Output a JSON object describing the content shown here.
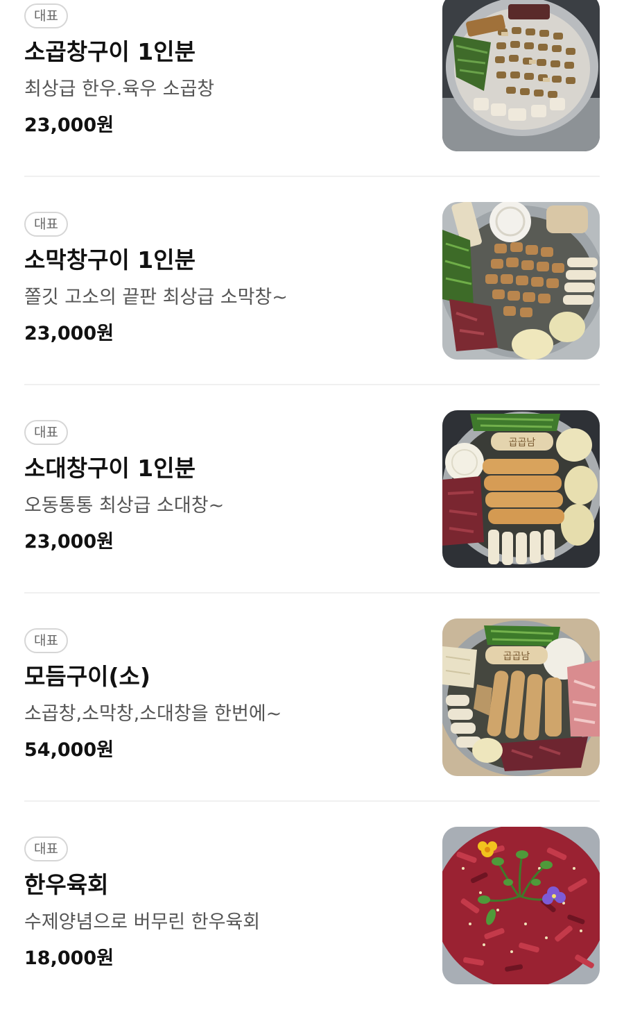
{
  "menu": {
    "items": [
      {
        "badge": "대표",
        "name": "소곱창구이 1인분",
        "description": "최상급 한우.육우 소곱창",
        "price": "23,000원",
        "image": "grilled-beef-small-intestine-photo"
      },
      {
        "badge": "대표",
        "name": "소막창구이 1인분",
        "description": "쫄깃 고소의 끝판 최상급 소막창~",
        "price": "23,000원",
        "image": "grilled-beef-abomasum-photo"
      },
      {
        "badge": "대표",
        "name": "소대창구이 1인분",
        "description": "오동통통 최상급 소대창~",
        "price": "23,000원",
        "image": "grilled-beef-large-intestine-photo"
      },
      {
        "badge": "대표",
        "name": "모듬구이(소)",
        "description": "소곱창,소막창,소대창을 한번에~",
        "price": "54,000원",
        "image": "assorted-grill-photo"
      },
      {
        "badge": "대표",
        "name": "한우육회",
        "description": "수제양념으로 버무린 한우육회",
        "price": "18,000원",
        "image": "korean-beef-tartare-photo"
      }
    ]
  }
}
